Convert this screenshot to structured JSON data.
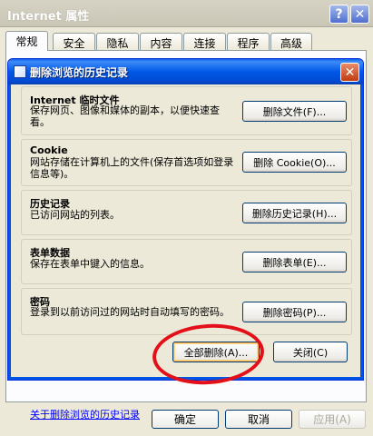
{
  "outer": {
    "title": "Internet 属性",
    "help_glyph": "?",
    "close_glyph": "✕",
    "tabs": [
      "常规",
      "安全",
      "隐私",
      "内容",
      "连接",
      "程序",
      "高级"
    ],
    "buttons": {
      "ok": "确定",
      "cancel": "取消",
      "apply": "应用(A)"
    }
  },
  "dialog": {
    "title": "删除浏览的历史记录",
    "close_glyph": "✕",
    "groups": [
      {
        "title": "Internet 临时文件",
        "desc": "保存网页、图像和媒体的副本，以便快速查看。",
        "button": "删除文件(F)..."
      },
      {
        "title": "Cookie",
        "desc": "网站存储在计算机上的文件(保存首选项如登录信息等)。",
        "button": "删除 Cookie(O)..."
      },
      {
        "title": "历史记录",
        "desc": "已访问网站的列表。",
        "button": "删除历史记录(H)..."
      },
      {
        "title": "表单数据",
        "desc": "保存在表单中键入的信息。",
        "button": "删除表单(E)..."
      },
      {
        "title": "密码",
        "desc": "登录到以前访问过的网站时自动填写的密码。",
        "button": "删除密码(P)..."
      }
    ],
    "link": "关于删除浏览的历史记录",
    "delete_all": "全部删除(A)...",
    "close": "关闭(C)"
  },
  "colors": {
    "dialog_title": "#0058e6",
    "highlight_circle": "#e3101a",
    "link": "#0000ff"
  }
}
